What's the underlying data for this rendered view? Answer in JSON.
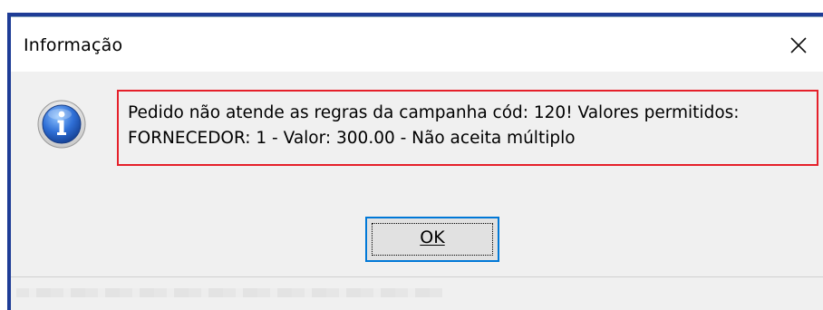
{
  "window": {
    "title": "Informação",
    "close_icon": "close-icon"
  },
  "message": {
    "icon": "info-icon",
    "line1": "Pedido não atende as regras da campanha cód: 120! Valores permitidos:",
    "line2": "FORNECEDOR: 1 - Valor: 300.00 - Não aceita múltiplo",
    "highlight_color": "#e5202a"
  },
  "buttons": {
    "ok_label": "OK"
  },
  "colors": {
    "window_frame": "#1e3c96",
    "dialog_bg": "#f0f0f0",
    "button_focus_border": "#0078d7"
  }
}
